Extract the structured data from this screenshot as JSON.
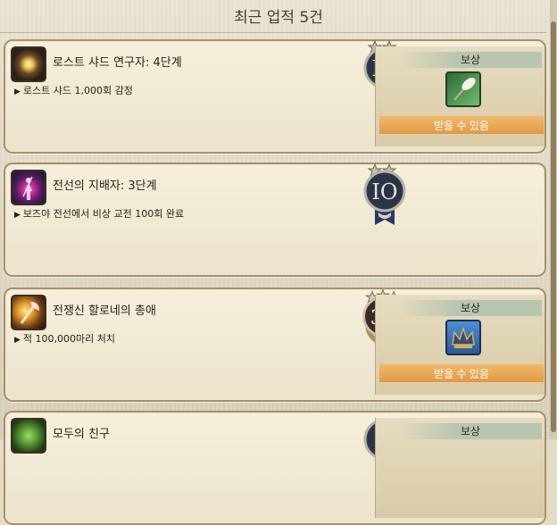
{
  "header": {
    "title": "최근 업적 5건"
  },
  "achievements": [
    {
      "title": "로스트 샤드 연구자: 4단계",
      "desc": "로스트 샤드 1,000회 감정",
      "medal": "IO",
      "has_reward": true,
      "reward_label": "보상",
      "claim_label": "받을 수 있음"
    },
    {
      "title": "전선의 지배자: 3단계",
      "desc": "보즈야 전선에서 비상 교전 100회 완료",
      "medal": "IO",
      "has_reward": false
    },
    {
      "title": "전쟁신 할로네의 총애",
      "desc": "적 100,000마리 처치",
      "medal": "30",
      "has_reward": true,
      "reward_label": "보상",
      "claim_label": "받을 수 있음"
    },
    {
      "title": "모두의 친구",
      "medal": "O",
      "has_reward": true,
      "reward_label": "보상"
    }
  ]
}
